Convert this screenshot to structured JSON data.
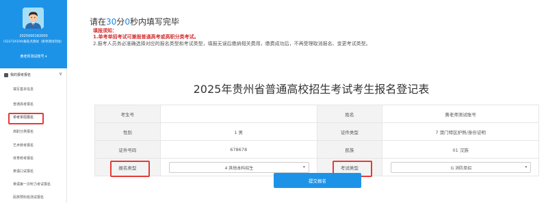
{
  "sidebar": {
    "profile": {
      "id_line": "2025000182000",
      "school_line": "(522724100)报名点测试（各项测试勿动）",
      "user_line": "黄老师测试账号 ▾"
    },
    "group": {
      "label": "我的报考报名",
      "chev": "∨"
    },
    "items": [
      {
        "label": "填写基本信息"
      },
      {
        "label": "普通高考报名"
      },
      {
        "label": "单考单招报名",
        "active": true
      },
      {
        "label": "高职分类报名"
      },
      {
        "label": "艺术统考报名"
      },
      {
        "label": "体育统考报名"
      },
      {
        "label": "英语口试报名"
      },
      {
        "label": "英语第一次听力考试报名"
      },
      {
        "label": "民族预科班测试报名"
      }
    ]
  },
  "notice": {
    "timer_prefix": "请在",
    "timer_minutes": "30",
    "timer_min_unit": "分",
    "timer_seconds": "0",
    "timer_suffix": "秒内填写完毕",
    "title": "填报须知：",
    "line1": "1.单考单招考试可兼报普通高考或高职分类考试。",
    "line2": "2.报考人员务必准确选择对应的报名类型和考试类型，填报无误后缴纳相关费用，缴费成功后，不再受理取消报名、变更考试类型。"
  },
  "form": {
    "title": "2025年贵州省普通高校招生考试考生报名登记表",
    "rows": [
      [
        {
          "label": "考生号",
          "value": ""
        },
        {
          "label": "姓名",
          "value": "黄老师测试账号"
        }
      ],
      [
        {
          "label": "性别",
          "value": "1 男"
        },
        {
          "label": "证件类型",
          "value": "7 澳门特区护照/身份证明"
        }
      ],
      [
        {
          "label": "证件号码",
          "value": "678678"
        },
        {
          "label": "民族",
          "value": "01 汉族"
        }
      ]
    ],
    "select_row": {
      "left_label": "报名类型",
      "left_value": "4 其他本科招生",
      "right_label": "考试类型",
      "right_value": "G 消防单招"
    },
    "submit_label": "提交报名"
  },
  "colors": {
    "primary": "#1d93e8",
    "highlight_box": "#e53935",
    "warning_text": "#d32f2f"
  }
}
